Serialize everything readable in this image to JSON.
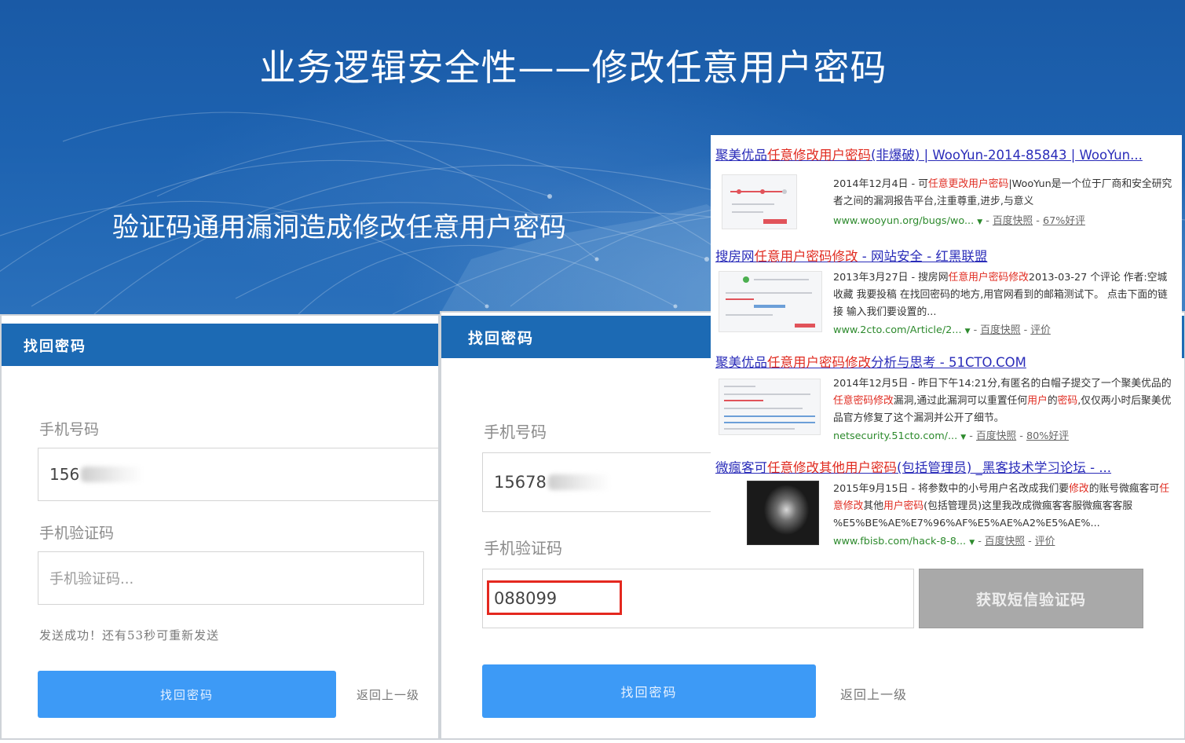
{
  "slide": {
    "title": "业务逻辑安全性——修改任意用户密码",
    "subtitle": "验证码通用漏洞造成修改任意用户密码"
  },
  "left_form": {
    "header": "找回密码",
    "phone_label": "手机号码",
    "phone_value": "156",
    "code_label": "手机验证码",
    "code_placeholder": "手机验证码...",
    "status_message": "发送成功！还有53秒可重新发送",
    "submit_label": "找回密码",
    "back_label": "返回上一级"
  },
  "right_form": {
    "header": "找回密码",
    "phone_label": "手机号码",
    "phone_value": "15678",
    "code_label": "手机验证码",
    "code_value": "088099",
    "sms_button_label": "获取短信验证码",
    "submit_label": "找回密码",
    "back_label": "返回上一级"
  },
  "search_results": [
    {
      "title_parts": [
        "聚美优品",
        "任意修改用户密码",
        "(非爆破) | WooYun-2014-85843 | WooYun..."
      ],
      "snippet_parts": [
        "2014年12月4日 - 可",
        "任意更改用户密码",
        "|WooYun是一个位于厂商和安全研究者之间的漏洞报告平台,注重尊重,进步,与意义"
      ],
      "url": "www.wooyun.org/bugs/wo...",
      "snapshot": "百度快照",
      "rating": "67%好评"
    },
    {
      "title_parts": [
        "搜房网",
        "任意用户密码修改",
        " - 网站安全 - 红黑联盟"
      ],
      "snippet_parts": [
        "2013年3月27日 - 搜房网",
        "任意用户密码修改",
        "2013-03-27 个评论 作者:空城 收藏 我要投稿 在找回密码的地方,用官网看到的邮箱测试下。 点击下面的链接 输入我们要设置的..."
      ],
      "url": "www.2cto.com/Article/2...",
      "snapshot": "百度快照",
      "rating": "评价"
    },
    {
      "title_parts": [
        "聚美优品",
        "任意用户密码修改",
        "分析与思考 - 51CTO.COM"
      ],
      "snippet_parts": [
        "2014年12月5日 - 昨日下午14:21分,有匿名的白帽子提交了一个聚美优品的",
        "任意密码修改",
        "漏洞,通过此漏洞可以重置任何",
        "用户",
        "的",
        "密码",
        ",仅仅两小时后聚美优品官方修复了这个漏洞并公开了细节。"
      ],
      "url": "netsecurity.51cto.com/...",
      "snapshot": "百度快照",
      "rating": "80%好评"
    },
    {
      "title_parts": [
        "微瘋客可",
        "任意修改其他",
        "用户密码",
        "(包括管理员) _黑客技术学习论坛 - ..."
      ],
      "snippet_parts": [
        "2015年9月15日 - 将参数中的小号用户名改成我们要",
        "修改",
        "的账号微瘋客可",
        "任意修改",
        "其他",
        "用户密码",
        "(包括管理员)这里我改成微瘋客客服微瘋客客服 %E5%BE%AE%E7%96%AF%E5%AE%A2%E5%AE%..."
      ],
      "url": "www.fbisb.com/hack-8-8...",
      "snapshot": "百度快照",
      "rating": "评价"
    }
  ],
  "colors": {
    "slide_blue": "#1d62b0",
    "form_header": "#1c6ab4",
    "primary_button": "#3d9af6",
    "highlight_red": "#e4281f",
    "link_blue": "#2a2cb9",
    "keyword_red": "#e02b20",
    "url_green": "#2d8a2d"
  }
}
